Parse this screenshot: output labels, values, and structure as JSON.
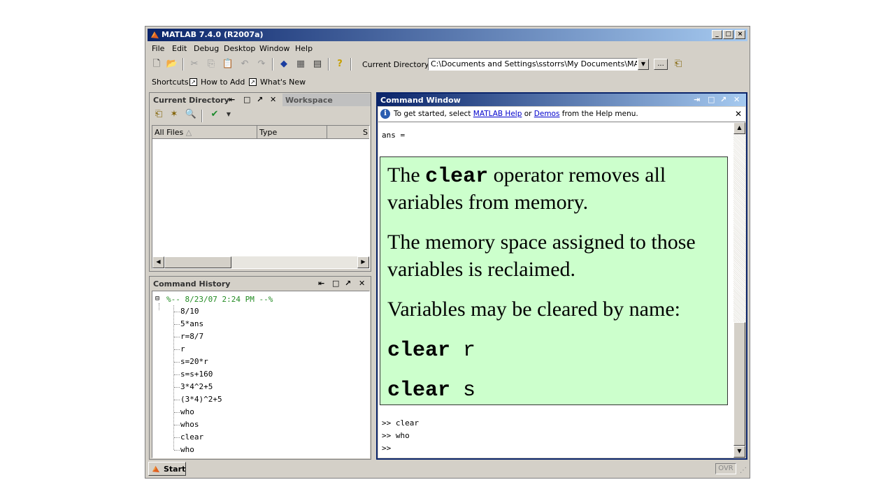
{
  "window": {
    "title": "MATLAB  7.4.0 (R2007a)"
  },
  "menu": [
    "File",
    "Edit",
    "Debug",
    "Desktop",
    "Window",
    "Help"
  ],
  "toolbar": {
    "current_dir_label": "Current Directory:",
    "current_dir_value": "C:\\Documents and Settings\\sstorrs\\My Documents\\MATLAB",
    "browse_label": "..."
  },
  "shortcuts": {
    "label": "Shortcuts",
    "how_to_add": "How to Add",
    "whats_new": "What's New"
  },
  "current_directory_panel": {
    "tab_title": "Current Directory",
    "workspace_tab": "Workspace",
    "columns": [
      "All Files",
      "Type",
      "S"
    ]
  },
  "command_history": {
    "title": "Command History",
    "session_header": "%-- 8/23/07  2:24 PM --%",
    "entries": [
      "8/10",
      "5*ans",
      "r=8/7",
      "r",
      "s=20*r",
      "s=s+160",
      "3*4^2+5",
      "(3*4)^2+5",
      "who",
      "whos",
      "clear",
      "who"
    ]
  },
  "command_window": {
    "title": "Command Window",
    "info_prefix": "To get started, select ",
    "info_link1": "MATLAB Help",
    "info_mid": " or ",
    "info_link2": "Demos",
    "info_suffix": " from the Help menu.",
    "top_output": "ans =",
    "bottom_lines": [
      ">> clear",
      ">> who",
      ">>"
    ]
  },
  "callout": {
    "p1_a": "The ",
    "p1_code": "clear",
    "p1_b": " operator removes all",
    "p1_line2": "variables from memory.",
    "p2_line1": "The memory space assigned to those",
    "p2_line2": "variables is reclaimed.",
    "p3": "Variables may be cleared by name:",
    "cmd1": "clear",
    "arg1": " r",
    "cmd2": "clear",
    "arg2": " s"
  },
  "statusbar": {
    "start_label": "Start",
    "ovr_label": "OVR"
  },
  "colors": {
    "title_gradient_start": "#0a246a",
    "title_gradient_end": "#a6caf0",
    "callout_bg": "#ccffcc",
    "history_header": "#228b22",
    "panel_bg": "#d4d0c8"
  }
}
